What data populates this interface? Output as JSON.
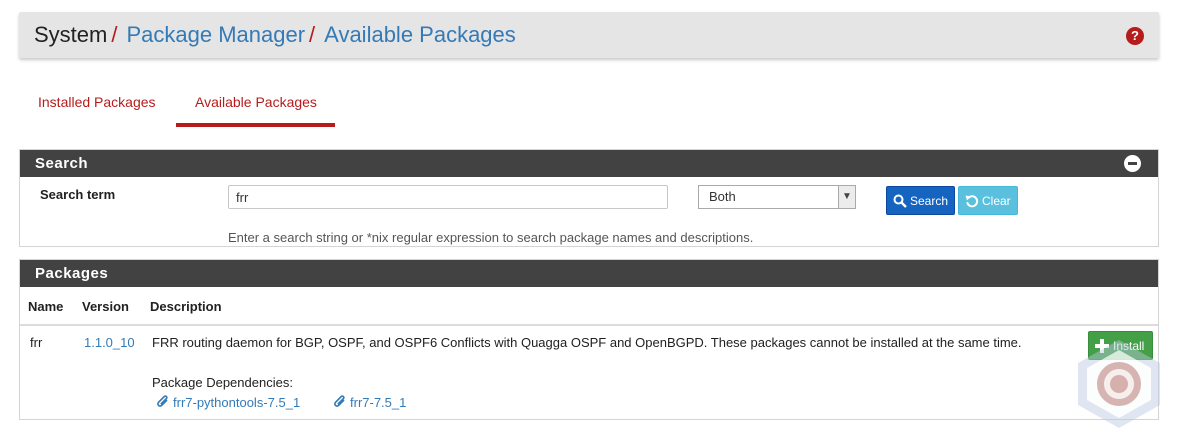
{
  "breadcrumb": {
    "items": [
      "System",
      "Package Manager",
      "Available Packages"
    ],
    "separator": "/"
  },
  "header": {
    "help_icon": "question-circle-icon"
  },
  "tabs": [
    {
      "label": "Installed Packages",
      "active": false
    },
    {
      "label": "Available Packages",
      "active": true
    }
  ],
  "search_panel": {
    "title": "Search",
    "collapse_icon": "minus-circle-icon",
    "label": "Search term",
    "term_value": "frr",
    "scope_value": "Both",
    "search_button": "Search",
    "clear_button": "Clear",
    "help_text": "Enter a search string or *nix regular expression to search package names and descriptions."
  },
  "packages_panel": {
    "title": "Packages",
    "columns": [
      "Name",
      "Version",
      "Description"
    ],
    "rows": [
      {
        "name": "frr",
        "version": "1.1.0_10",
        "description": "FRR routing daemon for BGP, OSPF, and OSPF6 Conflicts with Quagga OSPF and OpenBGPD. These packages cannot be installed at the same time.",
        "deps_label": "Package Dependencies:",
        "dependencies": [
          "frr7-pythontools-7.5_1",
          "frr7-7.5_1"
        ],
        "action": "Install"
      }
    ]
  },
  "colors": {
    "accent": "#b71c1c",
    "link": "#337ab7",
    "panel_heading": "#424242",
    "search_button": "#1565c0",
    "clear_button": "#5bc0de",
    "install_button": "#43a047"
  }
}
